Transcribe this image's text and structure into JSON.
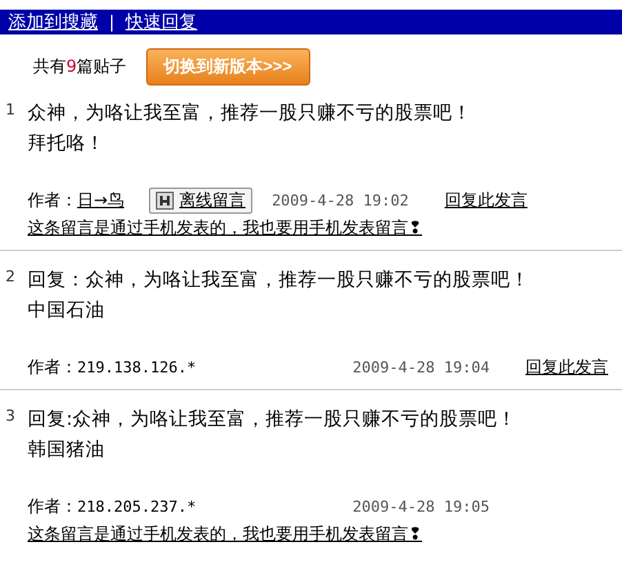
{
  "toolbar": {
    "links": [
      "添加到搜藏",
      "快速回复"
    ],
    "separator": "|"
  },
  "summary": {
    "prefix": "共有",
    "count": "9",
    "suffix": "篇贴子",
    "switch_button": "切换到新版本>>>"
  },
  "posts": [
    {
      "number": "1",
      "title": "众神，为咯让我至富，推荐一股只赚不亏的股票吧！",
      "body": "拜托咯！",
      "author_label": "作者：",
      "author": {
        "kind": "link",
        "text": "日→鸟"
      },
      "offline_button": "离线留言",
      "date": "2009-4-28 19:02",
      "reply_link": "回复此发言",
      "phone_note": "这条留言是通过手机发表的，我也要用手机发表留言❢"
    },
    {
      "number": "2",
      "title": "回复：众神，为咯让我至富，推荐一股只赚不亏的股票吧！",
      "body": "中国石油",
      "author_label": "作者：",
      "author": {
        "kind": "plain",
        "text": "219.138.126.*"
      },
      "date": "2009-4-28 19:04",
      "reply_link": "回复此发言"
    },
    {
      "number": "3",
      "title": "回复:众神，为咯让我至富，推荐一股只赚不亏的股票吧！",
      "body": "韩国猪油",
      "author_label": "作者：",
      "author": {
        "kind": "plain",
        "text": "218.205.237.*"
      },
      "date": "2009-4-28 19:05",
      "phone_note": "这条留言是通过手机发表的，我也要用手机发表留言❢"
    }
  ]
}
